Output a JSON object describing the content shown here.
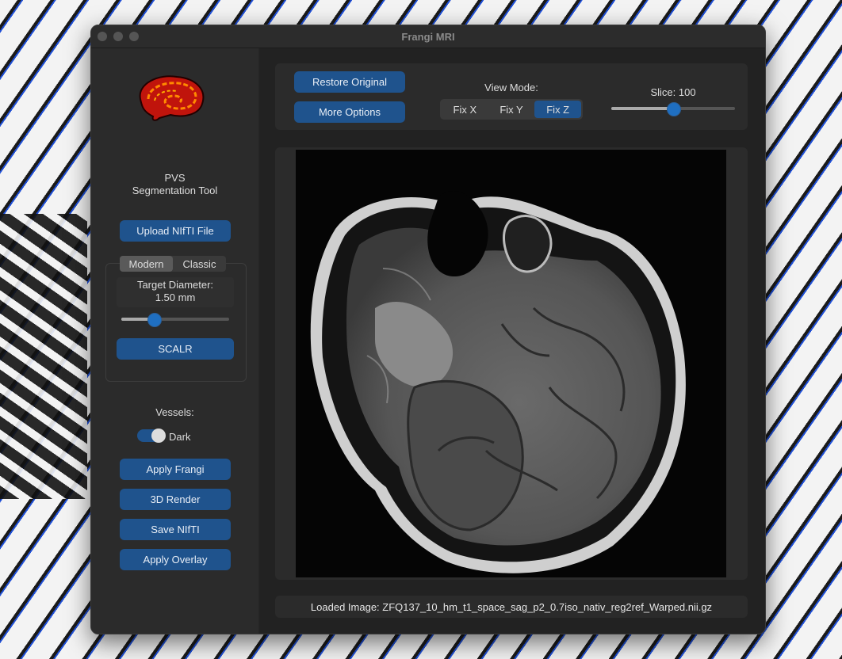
{
  "window": {
    "title": "Frangi MRI"
  },
  "sidebar": {
    "app_name_line1": "PVS",
    "app_name_line2": "Segmentation Tool",
    "upload_label": "Upload NIfTI File",
    "tabs": [
      {
        "label": "Modern",
        "selected": true
      },
      {
        "label": "Classic",
        "selected": false
      }
    ],
    "target_diameter_label": "Target Diameter:",
    "target_diameter_value": "1.50 mm",
    "target_diameter_slider_fraction": 0.3,
    "scalr_label": "SCALR",
    "vessels_label": "Vessels:",
    "vessels_toggle_label": "Dark",
    "vessels_toggle_on": true,
    "apply_frangi_label": "Apply Frangi",
    "render_3d_label": "3D Render",
    "save_nifti_label": "Save NIfTI",
    "apply_overlay_label": "Apply Overlay"
  },
  "toolbar": {
    "restore_label": "Restore Original",
    "more_options_label": "More Options",
    "view_mode_label": "View Mode:",
    "view_modes": [
      {
        "label": "Fix X",
        "selected": false
      },
      {
        "label": "Fix Y",
        "selected": false
      },
      {
        "label": "Fix Z",
        "selected": true
      }
    ],
    "slice_label": "Slice: 100",
    "slice_slider_fraction": 0.5
  },
  "status": {
    "loaded_image": "Loaded Image: ZFQ137_10_hm_t1_space_sag_p2_0.7iso_nativ_reg2ref_Warped.nii.gz"
  },
  "colors": {
    "accent": "#1f538d",
    "window_bg": "#262626",
    "panel_bg": "#2b2b2b"
  },
  "icons": {
    "logo": "brain-icon"
  }
}
